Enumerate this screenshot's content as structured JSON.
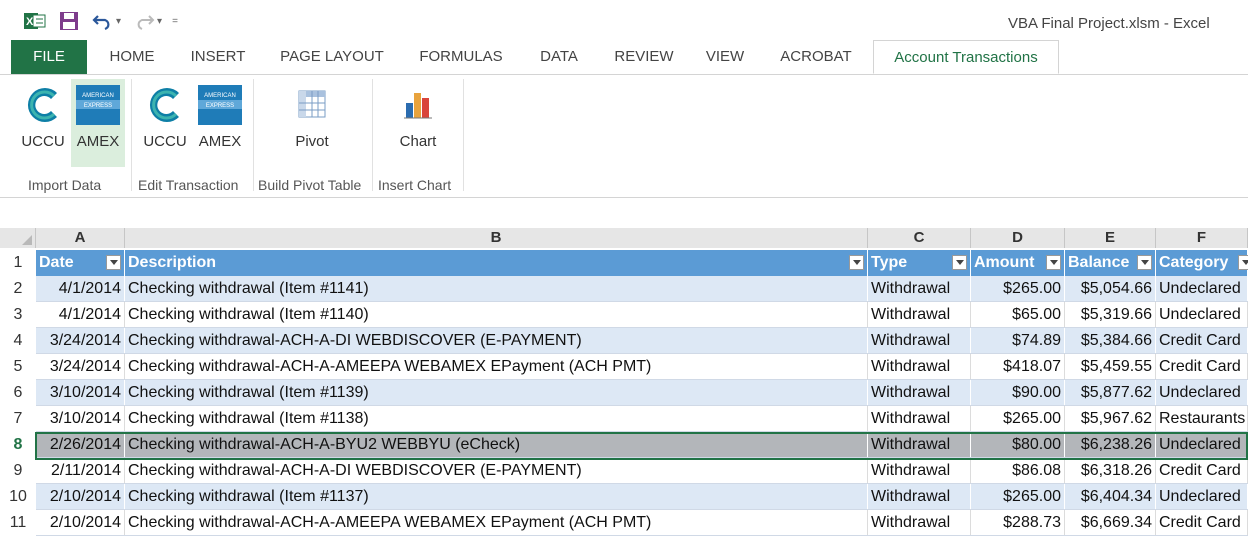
{
  "window": {
    "title": "VBA Final Project.xlsm - Excel"
  },
  "tabs": [
    {
      "label": "FILE"
    },
    {
      "label": "HOME"
    },
    {
      "label": "INSERT"
    },
    {
      "label": "PAGE LAYOUT"
    },
    {
      "label": "FORMULAS"
    },
    {
      "label": "DATA"
    },
    {
      "label": "REVIEW"
    },
    {
      "label": "VIEW"
    },
    {
      "label": "ACROBAT"
    },
    {
      "label": "Account Transactions"
    }
  ],
  "ribbon": {
    "buttons": [
      {
        "label": "UCCU",
        "icon": "uccu-logo-icon"
      },
      {
        "label": "AMEX",
        "icon": "amex-logo-icon",
        "selected": true
      },
      {
        "label": "UCCU",
        "icon": "uccu-logo-icon"
      },
      {
        "label": "AMEX",
        "icon": "amex-logo-icon"
      },
      {
        "label": "Pivot",
        "icon": "pivot-table-icon"
      },
      {
        "label": "Chart",
        "icon": "bar-chart-icon"
      }
    ],
    "groups": [
      {
        "label": "Import Data"
      },
      {
        "label": "Edit Transaction"
      },
      {
        "label": "Build Pivot Table"
      },
      {
        "label": "Insert Chart"
      }
    ]
  },
  "sheet": {
    "columns": [
      "A",
      "B",
      "C",
      "D",
      "E",
      "F"
    ],
    "header_row": {
      "num": "1",
      "cells": [
        "Date",
        "Description",
        "Type",
        "Amount",
        "Balance",
        "Category"
      ]
    },
    "rows": [
      {
        "num": "2",
        "cells": [
          "4/1/2014",
          "Checking withdrawal (Item #1141)",
          "Withdrawal",
          "$265.00",
          "$5,054.66",
          "Undeclared"
        ]
      },
      {
        "num": "3",
        "cells": [
          "4/1/2014",
          "Checking withdrawal (Item #1140)",
          "Withdrawal",
          "$65.00",
          "$5,319.66",
          "Undeclared"
        ]
      },
      {
        "num": "4",
        "cells": [
          "3/24/2014",
          "Checking withdrawal-ACH-A-DI WEBDISCOVER (E-PAYMENT)",
          "Withdrawal",
          "$74.89",
          "$5,384.66",
          "Credit Card"
        ]
      },
      {
        "num": "5",
        "cells": [
          "3/24/2014",
          "Checking withdrawal-ACH-A-AMEEPA WEBAMEX EPayment (ACH PMT)",
          "Withdrawal",
          "$418.07",
          "$5,459.55",
          "Credit Card"
        ]
      },
      {
        "num": "6",
        "cells": [
          "3/10/2014",
          "Checking withdrawal (Item #1139)",
          "Withdrawal",
          "$90.00",
          "$5,877.62",
          "Undeclared"
        ]
      },
      {
        "num": "7",
        "cells": [
          "3/10/2014",
          "Checking withdrawal (Item #1138)",
          "Withdrawal",
          "$265.00",
          "$5,967.62",
          "Restaurants"
        ]
      },
      {
        "num": "8",
        "cells": [
          "2/26/2014",
          "Checking withdrawal-ACH-A-BYU2 WEBBYU (eCheck)",
          "Withdrawal",
          "$80.00",
          "$6,238.26",
          "Undeclared"
        ],
        "selected": true
      },
      {
        "num": "9",
        "cells": [
          "2/11/2014",
          "Checking withdrawal-ACH-A-DI WEBDISCOVER (E-PAYMENT)",
          "Withdrawal",
          "$86.08",
          "$6,318.26",
          "Credit Card"
        ]
      },
      {
        "num": "10",
        "cells": [
          "2/10/2014",
          "Checking withdrawal (Item #1137)",
          "Withdrawal",
          "$265.00",
          "$6,404.34",
          "Undeclared"
        ]
      },
      {
        "num": "11",
        "cells": [
          "2/10/2014",
          "Checking withdrawal-ACH-A-AMEEPA WEBAMEX EPayment (ACH PMT)",
          "Withdrawal",
          "$288.73",
          "$6,669.34",
          "Credit Card"
        ]
      }
    ]
  },
  "colors": {
    "excel_green": "#217346",
    "table_header": "#5b9bd5",
    "band": "#dde8f5",
    "selected_row": "#b3b6ba"
  }
}
